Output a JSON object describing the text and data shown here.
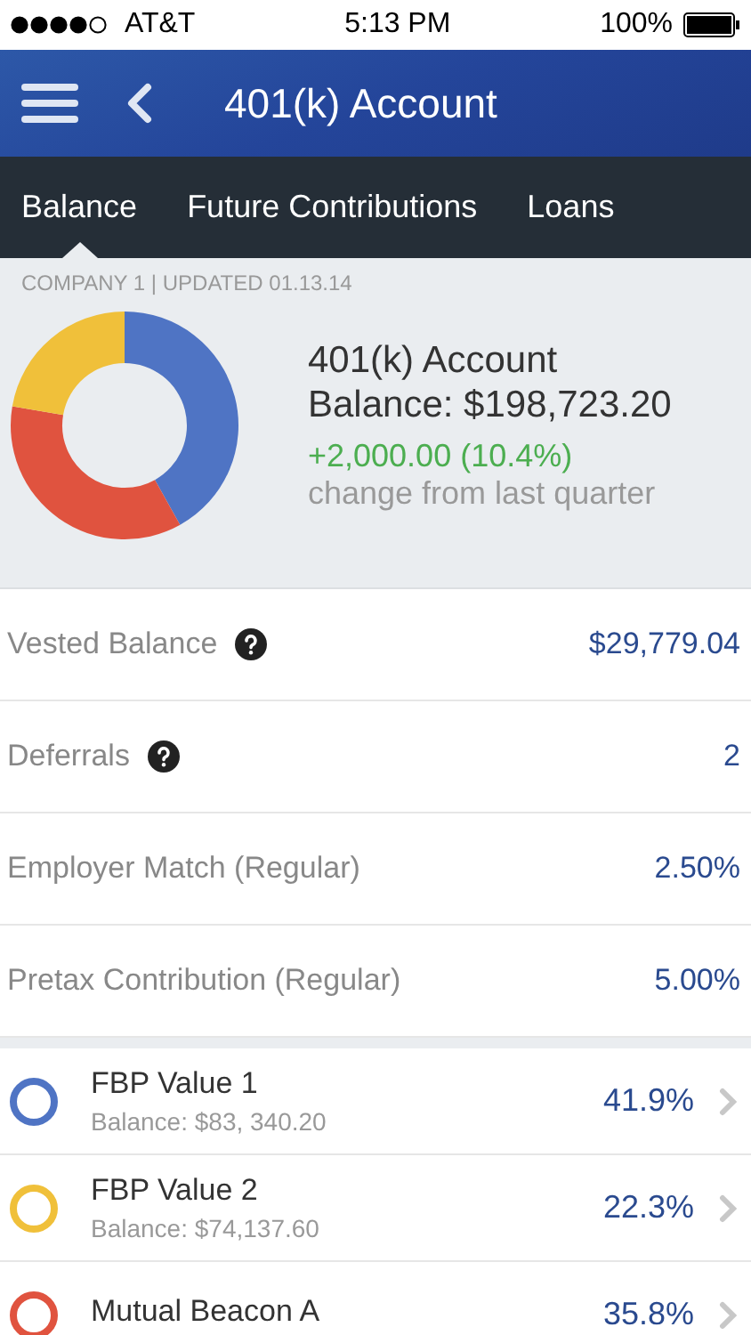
{
  "status_bar": {
    "carrier": "AT&T",
    "time": "5:13 PM",
    "battery": "100%"
  },
  "header": {
    "title": "401(k) Account"
  },
  "tabs": [
    {
      "label": "Balance",
      "selected": true
    },
    {
      "label": "Future Contributions",
      "selected": false
    },
    {
      "label": "Loans",
      "selected": false
    }
  ],
  "summary": {
    "meta": "COMPANY 1 | UPDATED 01.13.14",
    "title": "401(k) Account",
    "balance": "Balance: $198,723.20",
    "change": "+2,000.00 (10.4%)",
    "change_note": "change from last quarter"
  },
  "details": [
    {
      "label": "Vested Balance",
      "help": true,
      "value": "$29,779.04"
    },
    {
      "label": "Deferrals",
      "help": true,
      "value": "2"
    },
    {
      "label": "Employer Match (Regular)",
      "help": false,
      "value": "2.50%"
    },
    {
      "label": "Pretax Contribution (Regular)",
      "help": false,
      "value": "5.00%"
    }
  ],
  "funds": [
    {
      "name": "FBP Value 1",
      "balance": "Balance: $83, 340.20",
      "share": "41.9%",
      "color": "#4f74c4"
    },
    {
      "name": "FBP Value 2",
      "balance": "Balance: $74,137.60",
      "share": "22.3%",
      "color": "#f0c03a"
    },
    {
      "name": "Mutual Beacon A",
      "share": "35.8%",
      "color": "#e0533f"
    }
  ]
}
